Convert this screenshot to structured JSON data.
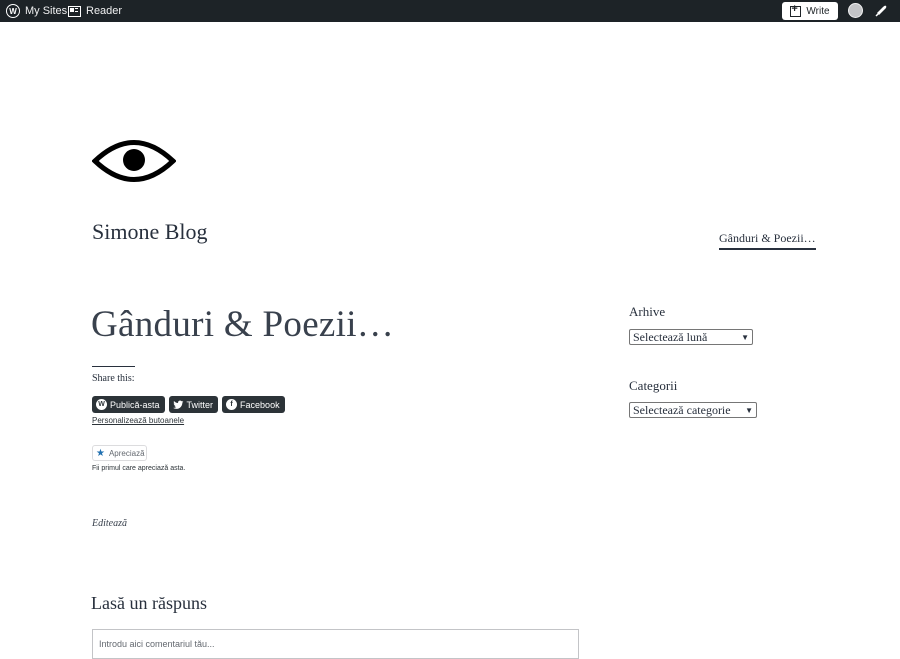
{
  "adminbar": {
    "my_sites": "My Sites",
    "reader": "Reader",
    "write": "Write"
  },
  "site": {
    "title": "Simone Blog",
    "menu_item": "Gânduri & Poezii…"
  },
  "post": {
    "title": "Gânduri & Poezii…",
    "share_title": "Share this:",
    "share_buttons": [
      "Publică-asta",
      "Twitter",
      "Facebook"
    ],
    "personalize": "Personalizează butoanele",
    "like_label": "Apreciază",
    "like_note": "Fii primul care apreciază asta.",
    "edit": "Editează"
  },
  "comments": {
    "title": "Lasă un răspuns",
    "placeholder": "Introdu aici comentariul tău..."
  },
  "sidebar": {
    "archive_title": "Arhive",
    "archive_select": "Selectează lună",
    "categories_title": "Categorii",
    "categories_select": "Selectează categorie"
  },
  "colors": {
    "adminbar_bg": "#1d2327",
    "text": "#28303d",
    "share_btn_bg": "#2c3338",
    "like_star": "#2271b1"
  }
}
